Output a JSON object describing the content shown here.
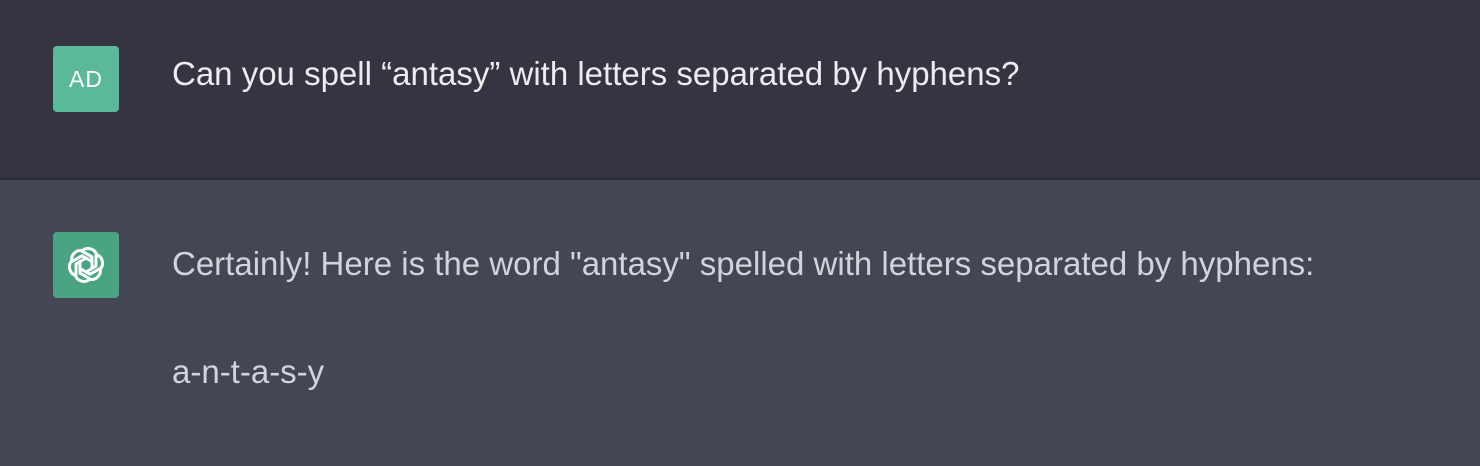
{
  "conversation": {
    "user": {
      "avatar_initials": "AD",
      "message": "Can you spell “antasy” with letters separated by hyphens?"
    },
    "assistant": {
      "avatar_icon": "openai-logo-icon",
      "message": "Certainly! Here is the word \"antasy\" spelled with letters separated by hyphens:",
      "answer": "a-n-t-a-s-y"
    }
  },
  "colors": {
    "user_row_bg": "#343541",
    "assistant_row_bg": "#444654",
    "user_avatar_bg": "#5bb89b",
    "assistant_avatar_bg": "#4aa482",
    "text_primary": "#ececf1",
    "text_secondary": "#d1d5db"
  }
}
